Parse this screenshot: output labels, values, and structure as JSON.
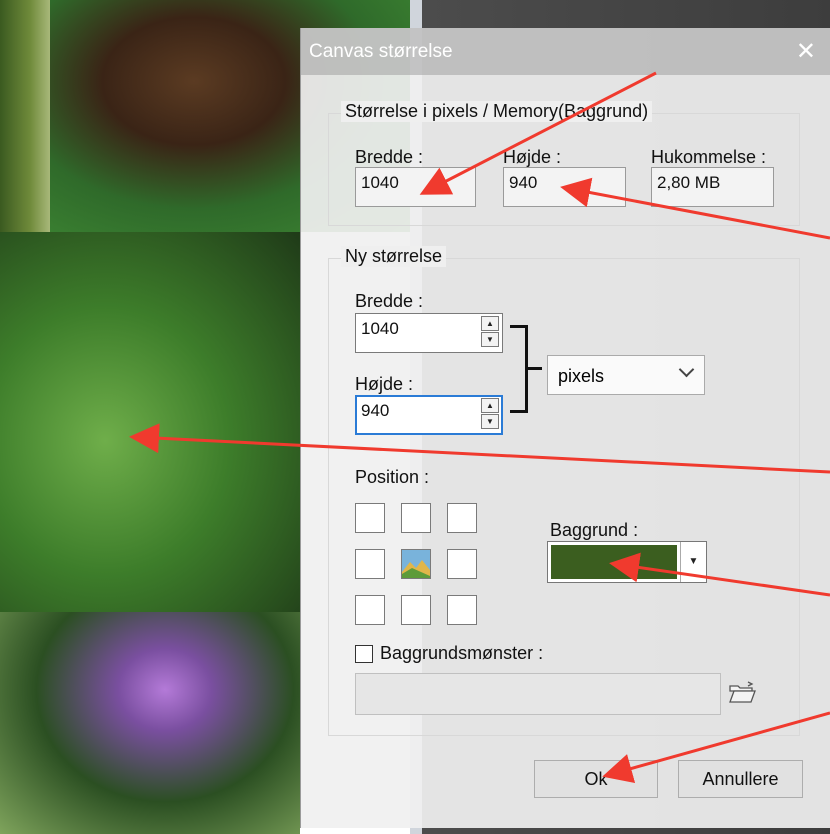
{
  "dialog": {
    "title": "Canvas størrelse",
    "close_glyph": "✕"
  },
  "current_size": {
    "legend": "Størrelse i pixels / Memory(Baggrund)",
    "width_label": "Bredde :",
    "width_value": "1040",
    "height_label": "Højde :",
    "height_value": "940",
    "memory_label": "Hukommelse :",
    "memory_value": "2,80 MB"
  },
  "new_size": {
    "legend": "Ny størrelse",
    "width_label": "Bredde :",
    "width_value": "1040",
    "height_label": "Højde :",
    "height_value": "940",
    "unit_selected": "pixels",
    "position_label": "Position :",
    "background_label": "Baggrund :",
    "background_color": "#3b5e1f",
    "pattern_label": "Baggrundsmønster :",
    "pattern_checked": false
  },
  "buttons": {
    "ok": "Ok",
    "cancel": "Annullere"
  },
  "colors": {
    "annotation_arrow": "#f03a2e",
    "focus_border": "#2a7bd6"
  }
}
